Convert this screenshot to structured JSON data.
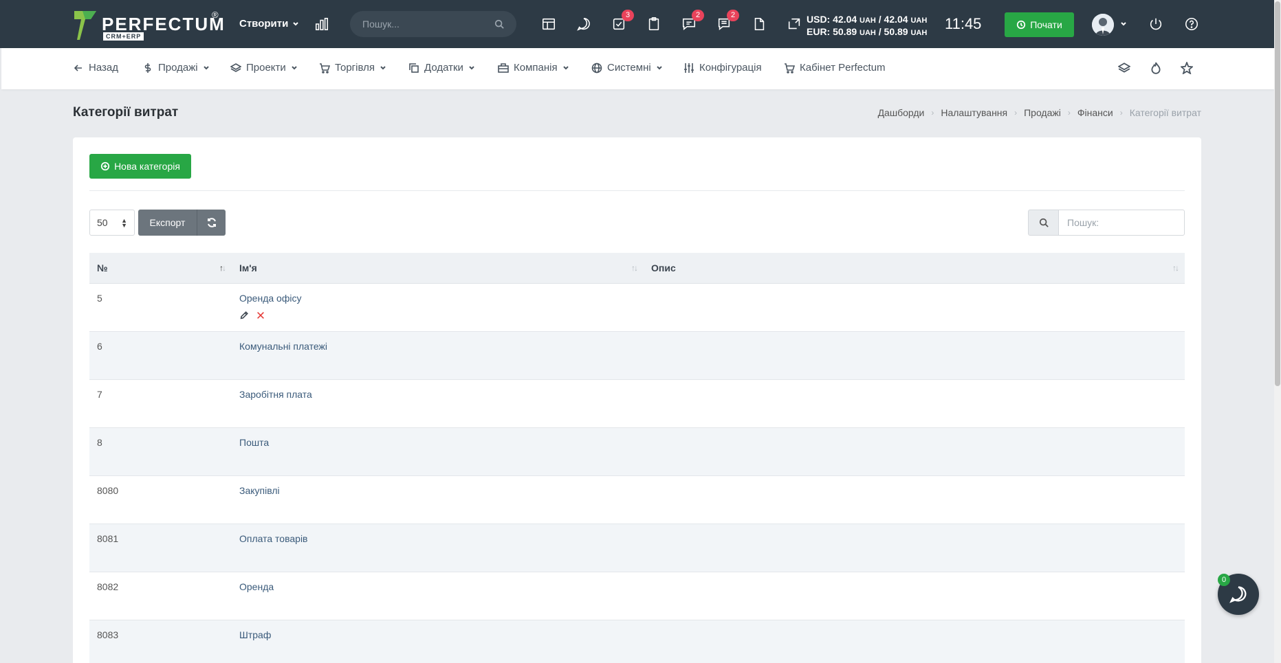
{
  "topbar": {
    "logo_word": "PERFECTUM",
    "logo_reg": "®",
    "logo_sub": "CRM+ERP",
    "create_label": "Створити",
    "search_placeholder": "Пошук...",
    "badges": {
      "tasks": "3",
      "messages": "2",
      "chats": "2"
    },
    "rates": {
      "usd_label": "USD: 42.04",
      "usd_unit1": "UAH",
      "usd_mid": " / 42.04 ",
      "usd_unit2": "UAH",
      "eur_label": "EUR: 50.89",
      "eur_unit1": "UAH",
      "eur_mid": " / 50.89 ",
      "eur_unit2": "UAH"
    },
    "clock": "11:45",
    "start_label": "Почати"
  },
  "menu": {
    "back": "Назад",
    "sales": "Продажі",
    "projects": "Проекти",
    "trade": "Торгівля",
    "addons": "Додатки",
    "company": "Компанія",
    "system": "Системні",
    "config": "Конфігурація",
    "cabinet": "Кабінет Perfectum"
  },
  "page": {
    "title": "Категорії витрат",
    "breadcrumb": [
      "Дашборди",
      "Налаштування",
      "Продажі",
      "Фінанси",
      "Категорії витрат"
    ]
  },
  "toolbar": {
    "new_category": "Нова категорія",
    "page_size": "50",
    "export": "Експорт",
    "search_placeholder": "Пошук:"
  },
  "table": {
    "columns": [
      "№",
      "Ім'я",
      "Опис"
    ],
    "rows": [
      {
        "id": "5",
        "name": "Оренда офісу",
        "desc": ""
      },
      {
        "id": "6",
        "name": "Комунальні платежі",
        "desc": ""
      },
      {
        "id": "7",
        "name": "Заробітня плата",
        "desc": ""
      },
      {
        "id": "8",
        "name": "Пошта",
        "desc": ""
      },
      {
        "id": "8080",
        "name": "Закупівлі",
        "desc": ""
      },
      {
        "id": "8081",
        "name": "Оплата товарів",
        "desc": ""
      },
      {
        "id": "8082",
        "name": "Оренда",
        "desc": ""
      },
      {
        "id": "8083",
        "name": "Штраф",
        "desc": ""
      }
    ]
  },
  "chat": {
    "badge": "0"
  },
  "colors": {
    "topbar": "#2d3a45",
    "accent_green": "#28a745",
    "badge_red": "#e9435b",
    "link": "#3a5a7a"
  }
}
